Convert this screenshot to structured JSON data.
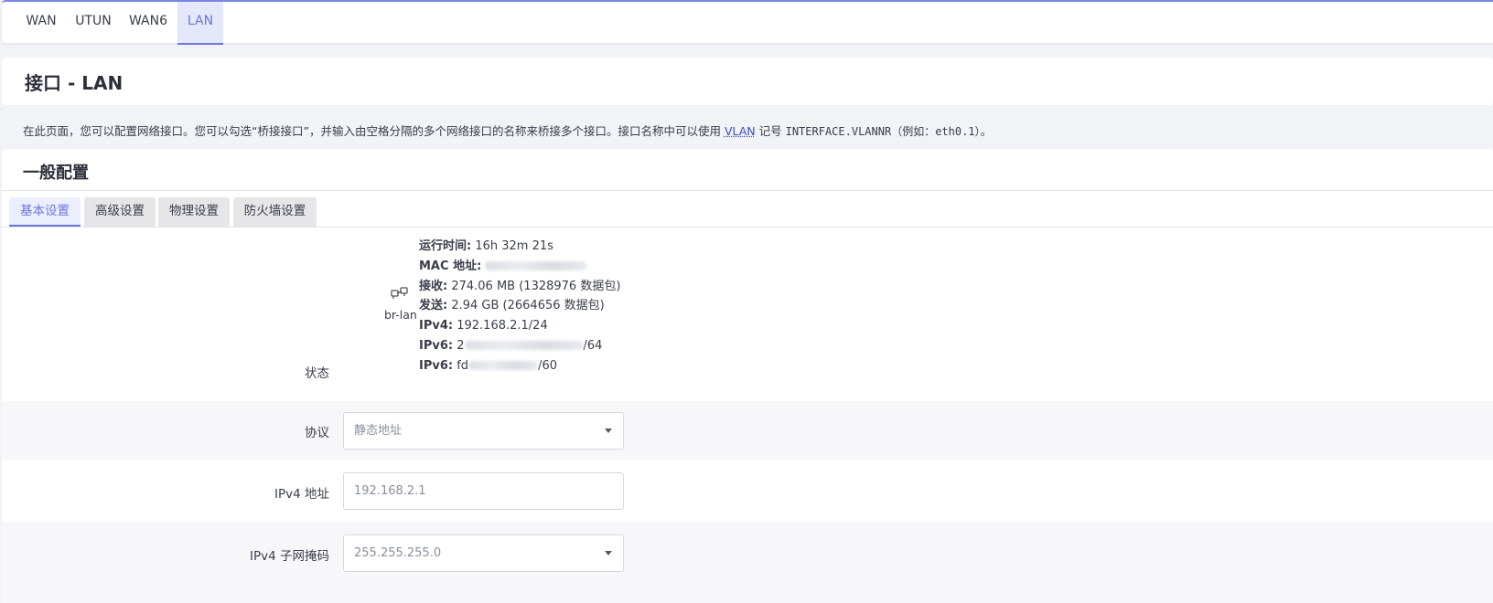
{
  "top_tabs": [
    {
      "label": "WAN"
    },
    {
      "label": "UTUN"
    },
    {
      "label": "WAN6"
    },
    {
      "label": "LAN"
    }
  ],
  "page_title": "接口 - LAN",
  "description": {
    "text_before": "在此页面，您可以配置网络接口。您可以勾选“桥接接口”，并输入由空格分隔的多个网络接口的名称来桥接多个接口。接口名称中可以使用 ",
    "link": "VLAN",
    "text_after_1": " 记号 ",
    "mono": "INTERFACE.VLANNR（例如：eth0.1）",
    "text_after_2": "。"
  },
  "section_title": "一般配置",
  "sub_tabs": [
    {
      "label": "基本设置"
    },
    {
      "label": "高级设置"
    },
    {
      "label": "物理设置"
    },
    {
      "label": "防火墙设置"
    }
  ],
  "status": {
    "label": "状态",
    "iface_name": "br-lan",
    "uptime_label": "运行时间:",
    "uptime_value": " 16h 32m 21s",
    "mac_label": "MAC 地址:",
    "rx_label": "接收:",
    "rx_value": " 274.06 MB (1328976 数据包)",
    "tx_label": "发送:",
    "tx_value": " 2.94 GB (2664656 数据包)",
    "ipv4_label": "IPv4:",
    "ipv4_value": " 192.168.2.1/24",
    "ipv6_label_1": "IPv6:",
    "ipv6_prefix_1": " 2",
    "ipv6_suffix_1": "/64",
    "ipv6_label_2": "IPv6:",
    "ipv6_prefix_2": " fd",
    "ipv6_suffix_2": "/60"
  },
  "form": {
    "protocol_label": "协议",
    "protocol_value": "静态地址",
    "ipv4_addr_label": "IPv4 地址",
    "ipv4_addr_value": "192.168.2.1",
    "netmask_label": "IPv4 子网掩码",
    "netmask_value": "255.255.255.0"
  }
}
